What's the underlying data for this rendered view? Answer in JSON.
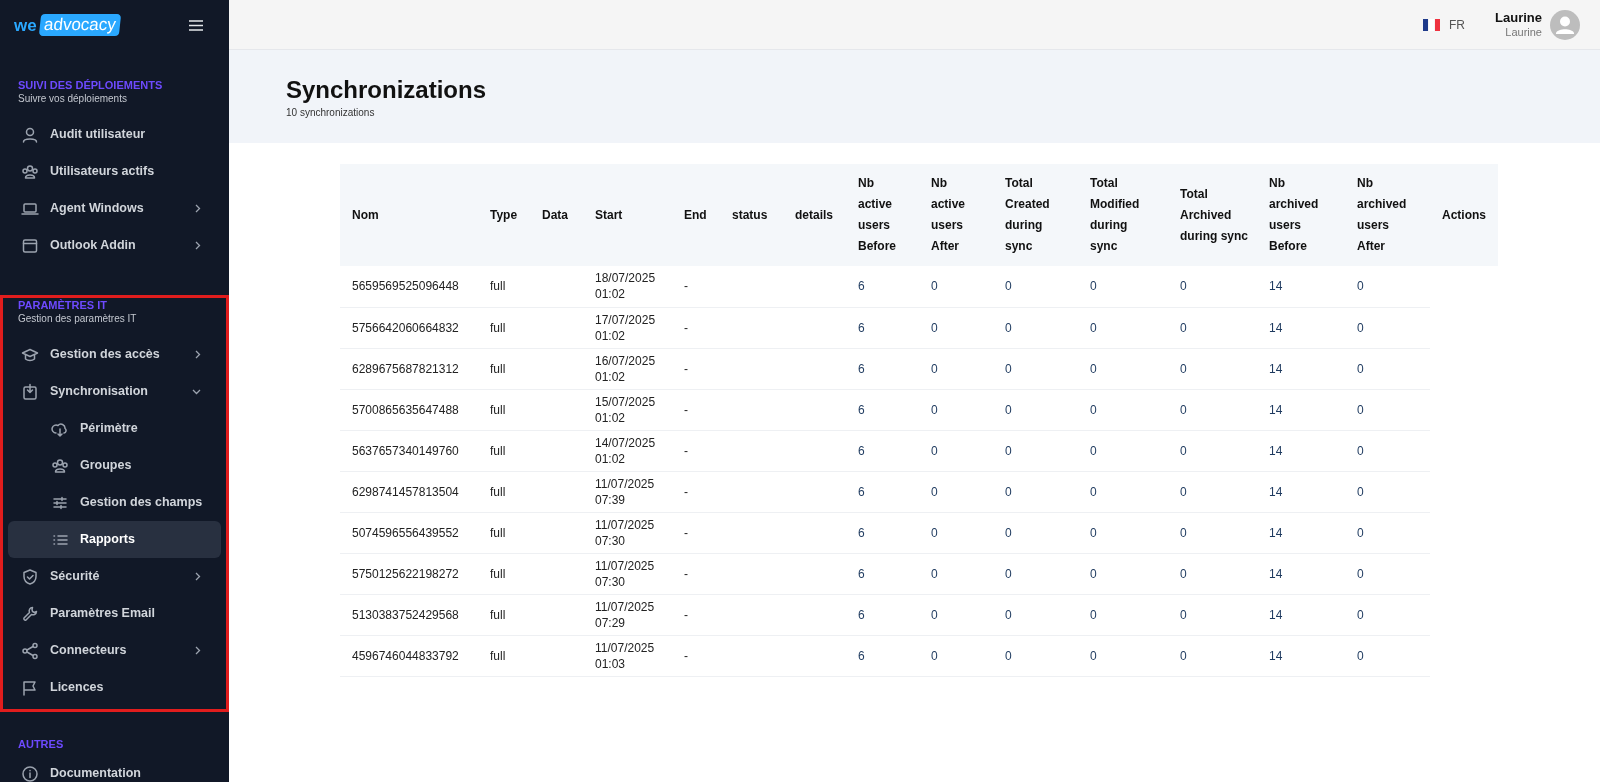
{
  "sidebar": {
    "logo": {
      "prefix": "we",
      "name": "advocacy"
    },
    "sections": [
      {
        "title": "SUIVI DES DÉPLOIEMENTS",
        "subtitle": "Suivre vos déploiements",
        "items": [
          {
            "label": "Audit utilisateur",
            "selected": false
          },
          {
            "label": "Utilisateurs actifs",
            "selected": false
          },
          {
            "label": "Agent Windows",
            "selected": false,
            "expanded": false
          },
          {
            "label": "Outlook Addin",
            "selected": false,
            "expanded": false
          }
        ]
      },
      {
        "title": "PARAMÈTRES IT",
        "subtitle": "Gestion des paramètres IT",
        "highlighted": true,
        "items": [
          {
            "label": "Gestion des accès",
            "selected": false,
            "expanded": false
          },
          {
            "label": "Synchronisation",
            "selected": false,
            "expanded": true,
            "children": [
              {
                "label": "Périmètre",
                "selected": false
              },
              {
                "label": "Groupes",
                "selected": false
              },
              {
                "label": "Gestion des champs",
                "selected": false
              },
              {
                "label": "Rapports",
                "selected": true
              }
            ]
          },
          {
            "label": "Sécurité",
            "selected": false,
            "expanded": false
          },
          {
            "label": "Paramètres Email",
            "selected": false
          },
          {
            "label": "Connecteurs",
            "selected": false,
            "expanded": false
          },
          {
            "label": "Licences",
            "selected": false
          }
        ]
      },
      {
        "title": "AUTRES",
        "items": [
          {
            "label": "Documentation",
            "selected": false
          }
        ]
      }
    ]
  },
  "topbar": {
    "language": "FR",
    "user": {
      "name": "Laurine",
      "subtitle": "Laurine"
    }
  },
  "page": {
    "title": "Synchronizations",
    "count": "10 synchronizations"
  },
  "table": {
    "columns": [
      "Nom",
      "Type",
      "Data",
      "Start",
      "End",
      "status",
      "details",
      "Nb active users Before",
      "Nb active users After",
      "Total Created during sync",
      "Total Modified during sync",
      "Total Archived during sync",
      "Nb archived users Before",
      "Nb archived users After",
      "Actions"
    ],
    "rows": [
      [
        "5659569525096448",
        "full",
        "",
        "18/07/2025 01:02",
        "-",
        "",
        "",
        "6",
        "0",
        "0",
        "0",
        "0",
        "14",
        "0"
      ],
      [
        "5756642060664832",
        "full",
        "",
        "17/07/2025 01:02",
        "-",
        "",
        "",
        "6",
        "0",
        "0",
        "0",
        "0",
        "14",
        "0"
      ],
      [
        "6289675687821312",
        "full",
        "",
        "16/07/2025 01:02",
        "-",
        "",
        "",
        "6",
        "0",
        "0",
        "0",
        "0",
        "14",
        "0"
      ],
      [
        "5700865635647488",
        "full",
        "",
        "15/07/2025 01:02",
        "-",
        "",
        "",
        "6",
        "0",
        "0",
        "0",
        "0",
        "14",
        "0"
      ],
      [
        "5637657340149760",
        "full",
        "",
        "14/07/2025 01:02",
        "-",
        "",
        "",
        "6",
        "0",
        "0",
        "0",
        "0",
        "14",
        "0"
      ],
      [
        "6298741457813504",
        "full",
        "",
        "11/07/2025 07:39",
        "-",
        "",
        "",
        "6",
        "0",
        "0",
        "0",
        "0",
        "14",
        "0"
      ],
      [
        "5074596556439552",
        "full",
        "",
        "11/07/2025 07:30",
        "-",
        "",
        "",
        "6",
        "0",
        "0",
        "0",
        "0",
        "14",
        "0"
      ],
      [
        "5750125622198272",
        "full",
        "",
        "11/07/2025 07:30",
        "-",
        "",
        "",
        "6",
        "0",
        "0",
        "0",
        "0",
        "14",
        "0"
      ],
      [
        "5130383752429568",
        "full",
        "",
        "11/07/2025 07:29",
        "-",
        "",
        "",
        "6",
        "0",
        "0",
        "0",
        "0",
        "14",
        "0"
      ],
      [
        "4596746044833792",
        "full",
        "",
        "11/07/2025 01:03",
        "-",
        "",
        "",
        "6",
        "0",
        "0",
        "0",
        "0",
        "14",
        "0"
      ]
    ]
  }
}
